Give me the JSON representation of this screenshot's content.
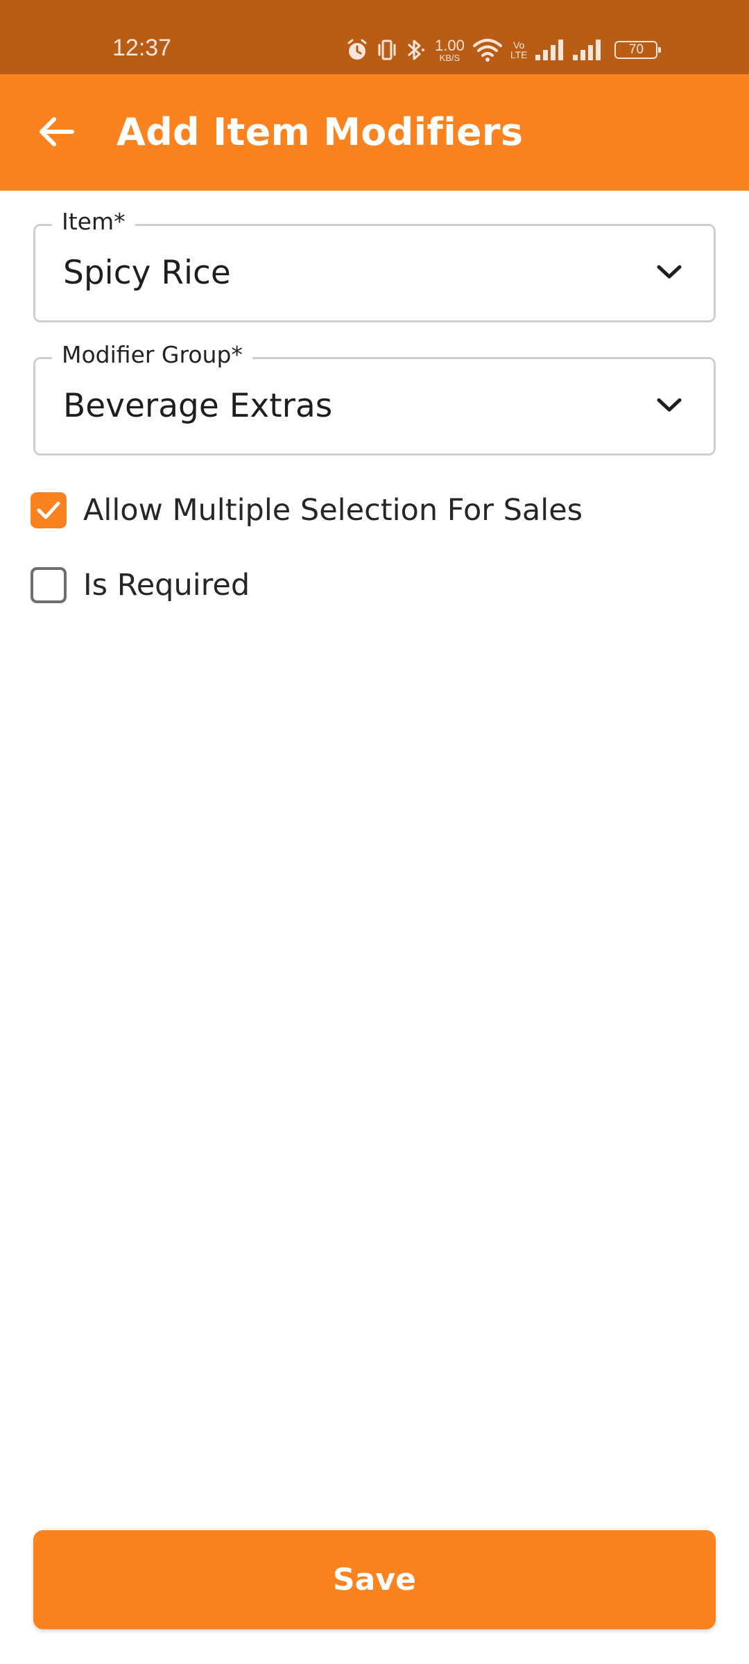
{
  "status_bar": {
    "time": "12:37",
    "net_speed_value": "1.00",
    "net_speed_unit": "KB/S",
    "volte_line1": "Vo",
    "volte_line2": "LTE",
    "battery": "70"
  },
  "app_bar": {
    "title": "Add Item Modifiers",
    "background_color": "#fb831f"
  },
  "form": {
    "item": {
      "label": "Item*",
      "value": "Spicy Rice"
    },
    "modifier_group": {
      "label": "Modifier Group*",
      "value": "Beverage Extras"
    },
    "allow_multiple": {
      "label": "Allow Multiple Selection For Sales",
      "checked": true
    },
    "is_required": {
      "label": "Is Required",
      "checked": false
    }
  },
  "actions": {
    "save_label": "Save"
  },
  "colors": {
    "accent": "#fb831f",
    "status_bar": "#b95d16"
  },
  "icons": {
    "back": "arrow-left-icon",
    "dropdown": "chevron-down-icon",
    "check": "checkmark-icon"
  }
}
